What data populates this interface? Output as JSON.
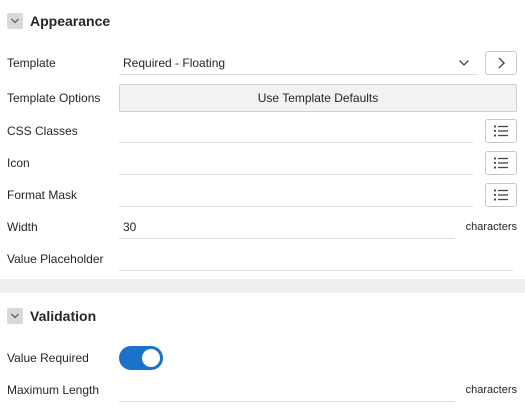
{
  "appearance": {
    "title": "Appearance",
    "template": {
      "label": "Template",
      "value": "Required - Floating"
    },
    "template_options": {
      "label": "Template Options",
      "button": "Use Template Defaults"
    },
    "css_classes": {
      "label": "CSS Classes",
      "value": ""
    },
    "icon": {
      "label": "Icon",
      "value": ""
    },
    "format_mask": {
      "label": "Format Mask",
      "value": ""
    },
    "width": {
      "label": "Width",
      "value": "30",
      "suffix": "characters"
    },
    "value_placeholder": {
      "label": "Value Placeholder",
      "value": ""
    }
  },
  "validation": {
    "title": "Validation",
    "value_required": {
      "label": "Value Required",
      "checked": true
    },
    "maximum_length": {
      "label": "Maximum Length",
      "value": "",
      "suffix": "characters"
    }
  },
  "colors": {
    "accent": "#1a73c8",
    "band": "#efefef"
  }
}
